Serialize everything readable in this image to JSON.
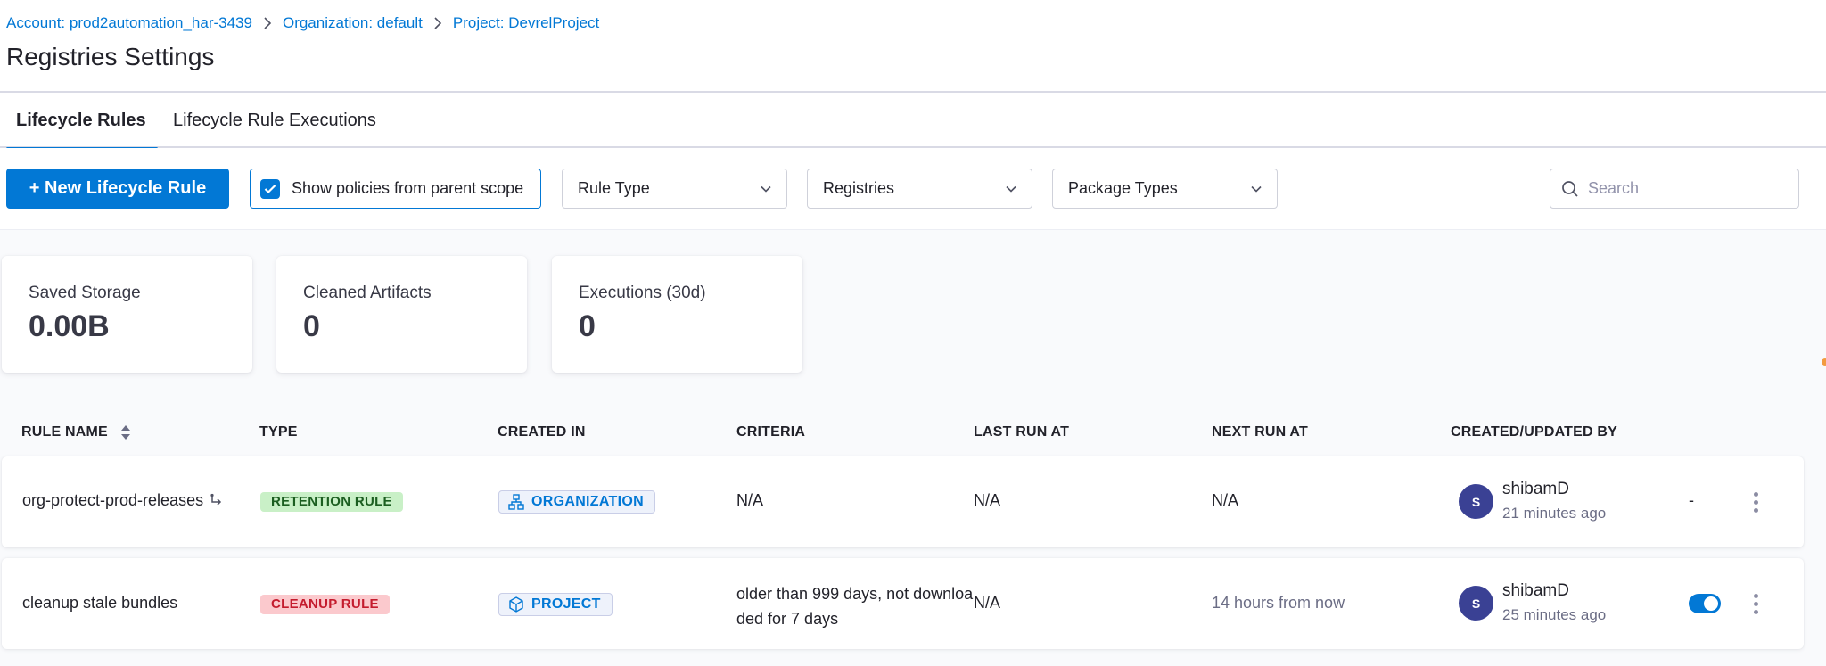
{
  "breadcrumb": {
    "account": "Account: prod2automation_har-3439",
    "organization": "Organization: default",
    "project": "Project: DevrelProject"
  },
  "page": {
    "title": "Registries Settings"
  },
  "tabs": [
    {
      "label": "Lifecycle Rules",
      "active": true
    },
    {
      "label": "Lifecycle Rule Executions",
      "active": false
    }
  ],
  "toolbar": {
    "new_rule_label": "+ New Lifecycle Rule",
    "parent_scope_label": "Show policies from parent scope",
    "parent_scope_checked": true,
    "rule_type_label": "Rule Type",
    "registries_label": "Registries",
    "package_types_label": "Package Types",
    "search_placeholder": "Search"
  },
  "stats": [
    {
      "label": "Saved Storage",
      "value": "0.00B"
    },
    {
      "label": "Cleaned Artifacts",
      "value": "0"
    },
    {
      "label": "Executions (30d)",
      "value": "0"
    }
  ],
  "table": {
    "columns": [
      "RULE NAME",
      "TYPE",
      "CREATED IN",
      "CRITERIA",
      "LAST RUN AT",
      "NEXT RUN AT",
      "CREATED/UPDATED BY"
    ],
    "rows": [
      {
        "name": "org-protect-prod-releases",
        "name_icon": "inherited-icon",
        "type": "RETENTION RULE",
        "scope": "ORGANIZATION",
        "scope_icon": "org-hierarchy-icon",
        "criteria": "N/A",
        "last_run": "N/A",
        "next_run": "N/A",
        "avatar_initial": "S",
        "user": "shibamD",
        "updated": "21 minutes ago",
        "status": "-"
      },
      {
        "name": "cleanup stale bundles",
        "type": "CLEANUP RULE",
        "scope": "PROJECT",
        "scope_icon": "project-cube-icon",
        "criteria_line1": "older than 999 days, not downloa",
        "criteria_line2": "ded for 7 days",
        "last_run": "N/A",
        "next_run": "14 hours from now",
        "avatar_initial": "S",
        "user": "shibamD",
        "updated": "25 minutes ago",
        "enabled": true
      }
    ]
  },
  "colors": {
    "accent": "#0278d5",
    "retention_bg": "#c9f0c7",
    "retention_text": "#1b5e20",
    "cleanup_bg": "#fbc9cd",
    "cleanup_text": "#c41c2e",
    "avatar": "#3a4194"
  }
}
